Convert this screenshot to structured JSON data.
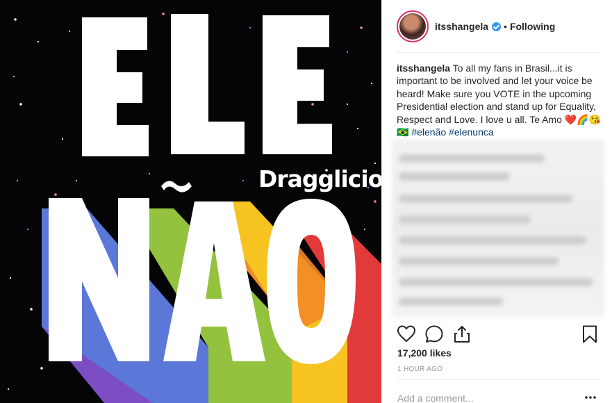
{
  "image": {
    "line1": "ELE",
    "line2": "NÃO",
    "watermark": "Dragglicious",
    "colors": {
      "background": "#050508",
      "red": "#e23a3a",
      "orange": "#f28a26",
      "yellow": "#f6c320",
      "green": "#93c23e",
      "blue": "#5b77d8",
      "purple": "#7c4ec4"
    }
  },
  "post": {
    "username": "itsshangela",
    "separator": "•",
    "follow_status": "Following",
    "caption_text": "To all my fans in Brasil...it is important to be involved and let your voice be heard! Make sure you VOTE in the upcoming Presidential election and stand up for Equality, Respect and Love. I love u all. Te Amo ❤️🌈😘🇧🇷",
    "hashtags": [
      "#elenão",
      "#elenunca"
    ],
    "likes": "17,200 likes",
    "timestamp": "1 HOUR AGO",
    "comment_placeholder": "Add a comment..."
  },
  "icons": [
    "verified-badge-icon",
    "heart-icon",
    "comment-icon",
    "share-icon",
    "bookmark-icon",
    "more-options-icon"
  ]
}
